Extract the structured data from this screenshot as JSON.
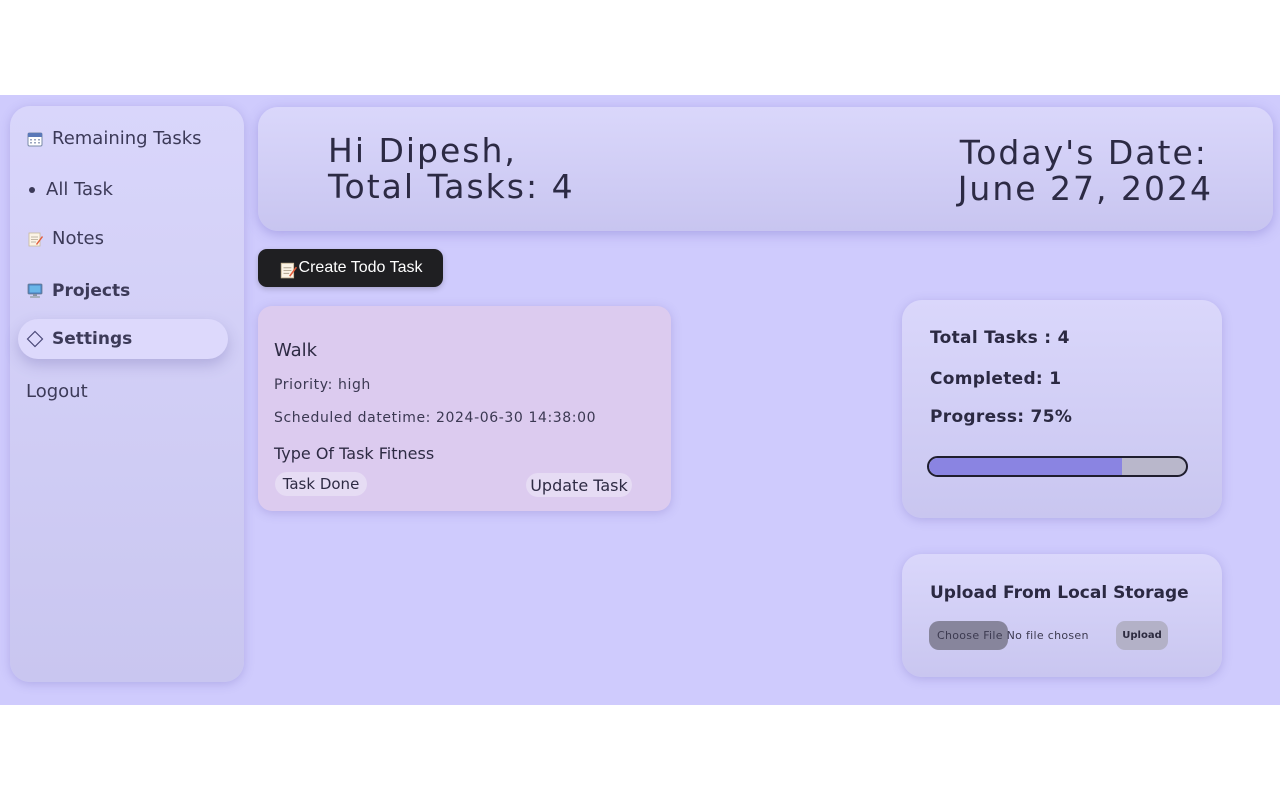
{
  "sidebar": {
    "items": [
      {
        "label": "Remaining Tasks",
        "icon": "calendar-icon"
      },
      {
        "label": "All Task",
        "icon": "bullet-icon"
      },
      {
        "label": "Notes",
        "icon": "memo-icon"
      },
      {
        "label": "Projects",
        "icon": "computer-icon"
      },
      {
        "label": "Settings",
        "icon": "diamond-icon"
      },
      {
        "label": "Logout"
      }
    ],
    "active_item": "Settings"
  },
  "header": {
    "greeting": "Hi Dipesh,",
    "total_tasks": "Total Tasks: 4",
    "date_label": "Today's Date:",
    "date_value": "June 27, 2024"
  },
  "create_button": {
    "label": "Create Todo Task",
    "icon": "memo-icon"
  },
  "task_card": {
    "title": "Walk",
    "priority": "Priority: high",
    "scheduled": "Scheduled datetime: 2024-06-30 14:38:00",
    "type": "Type Of Task Fitness",
    "done_label": "Task Done",
    "update_label": "Update Task"
  },
  "stats": {
    "total": "Total Tasks : 4",
    "completed": "Completed: 1",
    "progress": "Progress: 75%",
    "progress_value": 0.75
  },
  "upload": {
    "title": "Upload From Local Storage",
    "choose_file": "Choose File",
    "no_file": "No file chosen",
    "upload_label": "Upload"
  },
  "colors": {
    "background": "#cfcbfd",
    "accent": "#8a84e2",
    "button_dark": "#1f1f22",
    "task_card": "#dccbef"
  }
}
